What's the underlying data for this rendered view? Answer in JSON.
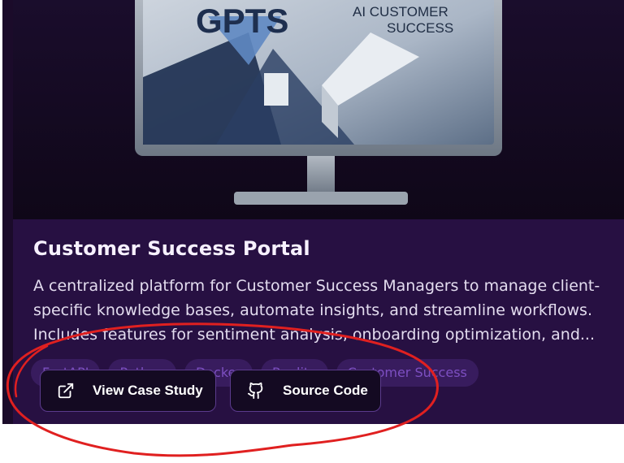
{
  "card": {
    "image_title_text": "GPTS",
    "image_subtitle_line1": "AI  CUSTOMER",
    "image_subtitle_line2": "SUCCESS",
    "title": "Customer Success Portal",
    "description": "A centralized platform for Customer Success Managers to manage client-specific knowledge bases, automate insights, and streamline workflows. Includes features for sentiment analysis, onboarding optimization, and...",
    "tags": [
      "FastAPI",
      "Python",
      "Docker",
      "Reality",
      "Customer Success"
    ],
    "buttons": {
      "view_case_study": "View Case Study",
      "source_code": "Source Code"
    }
  },
  "colors": {
    "card_bg": "#271042",
    "annotation": "#e02020",
    "accent": "#8c5ad8"
  }
}
